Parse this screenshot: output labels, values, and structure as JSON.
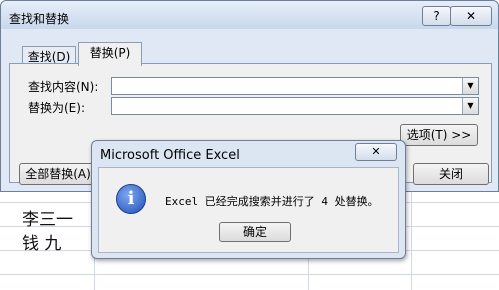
{
  "sheet": {
    "cells": [
      "李三一",
      "钱  九"
    ]
  },
  "find_dialog": {
    "title": "查找和替换",
    "help_label": "?",
    "close_label": "✕",
    "tabs": [
      {
        "label": "查找(D)"
      },
      {
        "label": "替换(P)"
      }
    ],
    "find_what_label": "查找内容(N):",
    "find_what_value": "",
    "replace_with_label": "替换为(E):",
    "replace_with_value": "",
    "options_button": "选项(T) >>",
    "replace_all_button": "全部替换(A)",
    "close_button": "关闭"
  },
  "message_box": {
    "title": "Microsoft Office Excel",
    "close_label": "✕",
    "icon": "information-icon",
    "icon_glyph": "i",
    "message": "Excel 已经完成搜索并进行了 4 处替换。",
    "ok_button": "确定"
  }
}
